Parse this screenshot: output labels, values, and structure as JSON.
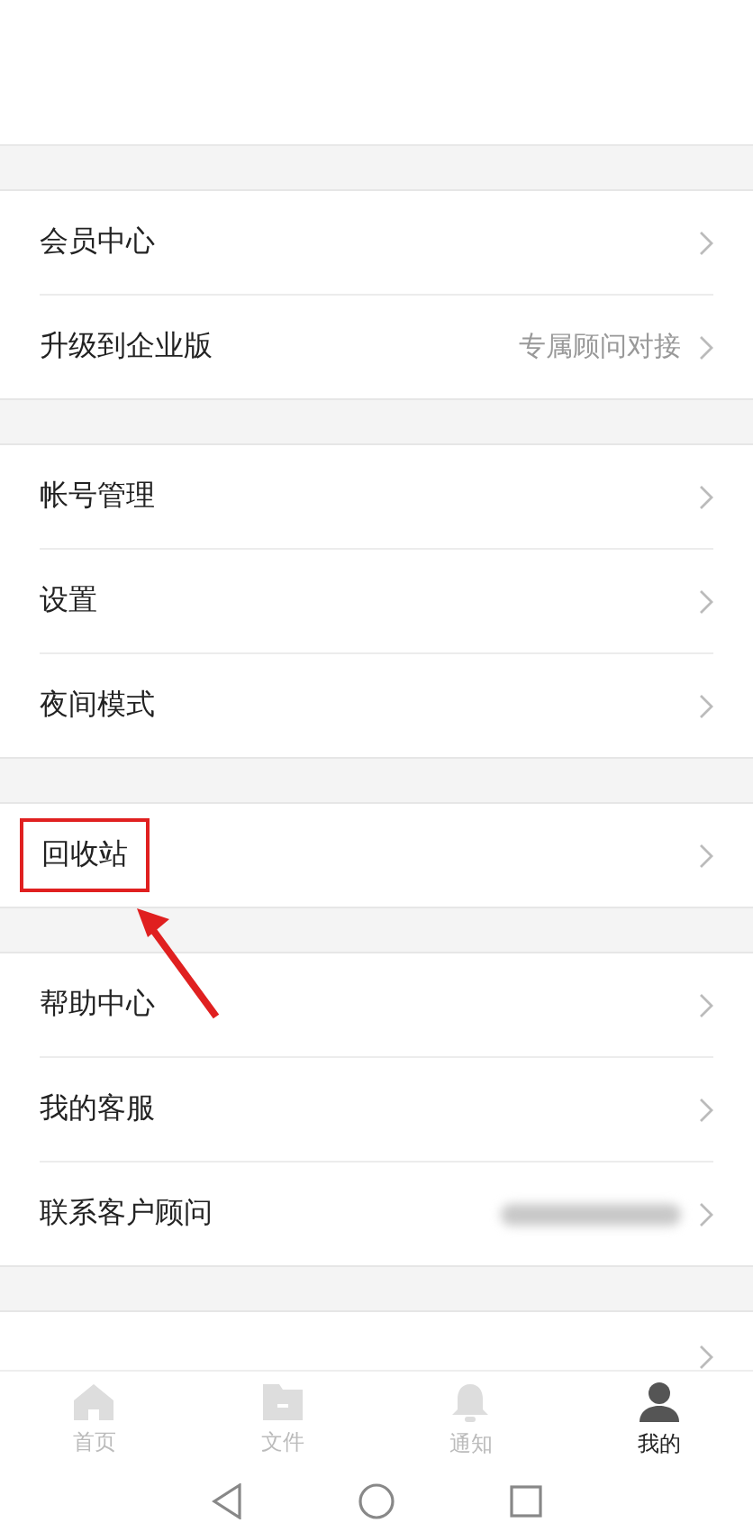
{
  "groups": [
    {
      "items": [
        {
          "label": "会员中心",
          "highlighted": false,
          "redacted": false
        },
        {
          "label": "升级到企业版",
          "value": "专属顾问对接",
          "highlighted": false,
          "redacted": false
        }
      ]
    },
    {
      "items": [
        {
          "label": "帐号管理",
          "highlighted": false,
          "redacted": false
        },
        {
          "label": "设置",
          "highlighted": false,
          "redacted": false
        },
        {
          "label": "夜间模式",
          "highlighted": false,
          "redacted": false
        }
      ]
    },
    {
      "items": [
        {
          "label": "回收站",
          "highlighted": true,
          "redacted": false
        }
      ]
    },
    {
      "items": [
        {
          "label": "帮助中心",
          "highlighted": false,
          "redacted": false
        },
        {
          "label": "我的客服",
          "highlighted": false,
          "redacted": false
        },
        {
          "label": "联系客户顾问",
          "highlighted": false,
          "redacted": true
        }
      ]
    }
  ],
  "tabs": [
    {
      "label": "首页",
      "kind": "home",
      "selected": false
    },
    {
      "label": "文件",
      "kind": "folder",
      "selected": false
    },
    {
      "label": "通知",
      "kind": "bell",
      "selected": false
    },
    {
      "label": "我的",
      "kind": "person",
      "selected": true
    }
  ]
}
